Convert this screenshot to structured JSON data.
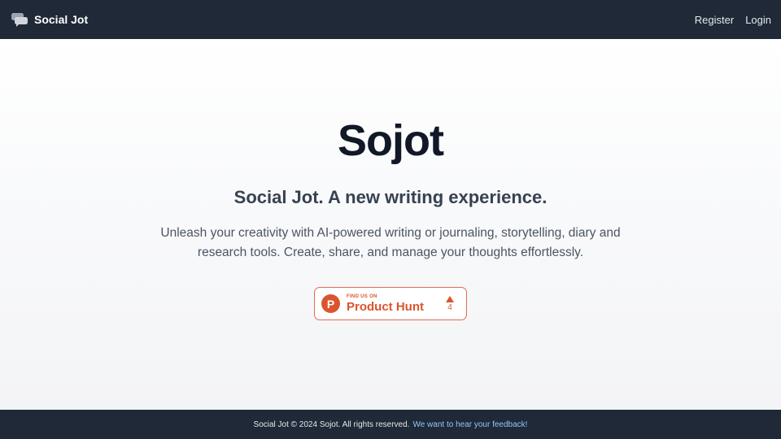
{
  "navbar": {
    "brand_name": "Social Jot",
    "brand_icon": "chat-bubbles-icon",
    "links": {
      "register": "Register",
      "login": "Login"
    }
  },
  "hero": {
    "title": "Sojot",
    "subtitle": "Social Jot. A new writing experience.",
    "description": "Unleash your creativity with AI-powered writing or journaling, storytelling, diary and research tools. Create, share, and manage your thoughts effortlessly."
  },
  "product_hunt_badge": {
    "logo_letter": "P",
    "small_text": "FIND US ON",
    "big_text": "Product Hunt",
    "vote_count": "4",
    "color": "#da552f"
  },
  "footer": {
    "copyright": "Social Jot © 2024 Sojot. All rights reserved.",
    "feedback_link": "We want to hear your feedback!"
  },
  "colors": {
    "navbar_bg": "#1f2937",
    "footer_bg": "#1f2937",
    "title": "#111827",
    "link_accent": "#93c5fd"
  }
}
